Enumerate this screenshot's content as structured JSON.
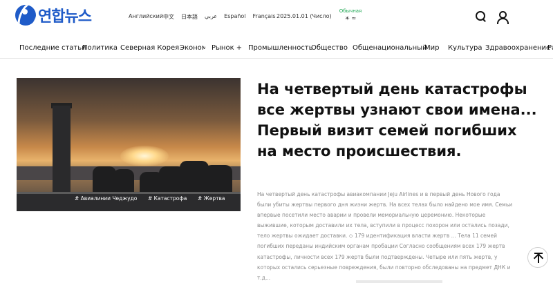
{
  "header": {
    "logo_text": "연합뉴스",
    "languages": [
      "Английский",
      "中文",
      "日本語",
      "عربي",
      "Español",
      "Français"
    ],
    "date": "2025.01.01 (Число)",
    "weather_label": "Обычная",
    "weather_symbol": "☀ ≈"
  },
  "nav": {
    "items": [
      "Последние статьи",
      "Политика",
      "Северная Корея",
      "Экономика",
      "Рынок +",
      "Промышленность",
      "Общество",
      "Общенациональный",
      "Мир",
      "Культура",
      "Здравоохранение",
      "Ра"
    ]
  },
  "article": {
    "headline": "На четвертый день катастрофы все жертвы узнают свои имена...\nПервый визит семей погибших на место происшествия.",
    "summary": "На четвертый день катастрофы авиакомпании Jeju Airlines и в первый день Нового года были убиты жертвы первого дня жизни жертв. На всех телах было найдено мое имя. Семьи впервые посетили место аварии и провели мемориальную церемонию. Некоторые выжившие, которым доставили их тела, вступили в процесс похорон или остались позади, тело жертвы ожидает доставки. ◇ 179 идентификация власти жертв ... Тела 11 семей погибших переданы индийским органам пробации Согласно сообщениям всех 179 жертв катастрофы, личности всех 179 жертв были подтверждены. Четыре или пять жертв, у которых остались серьезные повреждения, были повторно обследованы на предмет ДНК и т.д...",
    "tags": [
      "# Авиалинии Чеджудо",
      "# Катастрофа",
      "# Жертва"
    ]
  },
  "icons": {
    "search": "search-icon",
    "user": "user-icon",
    "scroll_top": "arrow-up-icon"
  }
}
